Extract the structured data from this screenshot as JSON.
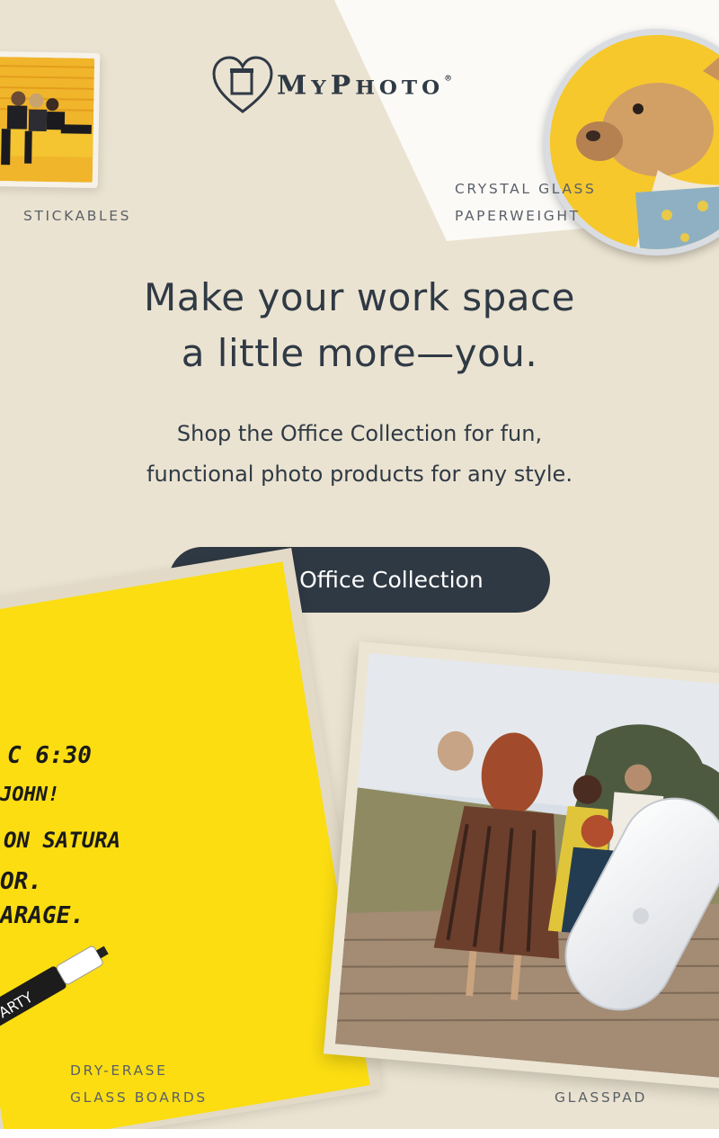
{
  "brand": {
    "name_first": "M",
    "name_y": "Y",
    "name_p": "P",
    "name_rest": "HOTO",
    "registered": "®"
  },
  "products": {
    "stickables": "STICKABLES",
    "paperweight_line1": "CRYSTAL GLASS",
    "paperweight_line2": "PAPERWEIGHT",
    "board_line1": "DRY-ERASE",
    "board_line2": "GLASS BOARDS",
    "glasspad": "GLASSPAD"
  },
  "headline": {
    "line1": "Make your work space",
    "line2": "a little more—you."
  },
  "subhead": {
    "line1": "Shop the Office Collection for fun,",
    "line2": "functional photo products for any style."
  },
  "cta": {
    "label": "Shop Office Collection"
  },
  "board_notes": {
    "line1": "C 6:30",
    "line2": "JOHN!",
    "line3": "ON SATURA",
    "line4": "OR.",
    "line5": "ARAGE."
  },
  "marker_text": "ARTY",
  "colors": {
    "background": "#ebe3d1",
    "text_dark": "#2f3a45",
    "button": "#2f3943",
    "board_yellow": "#fbdd12"
  }
}
